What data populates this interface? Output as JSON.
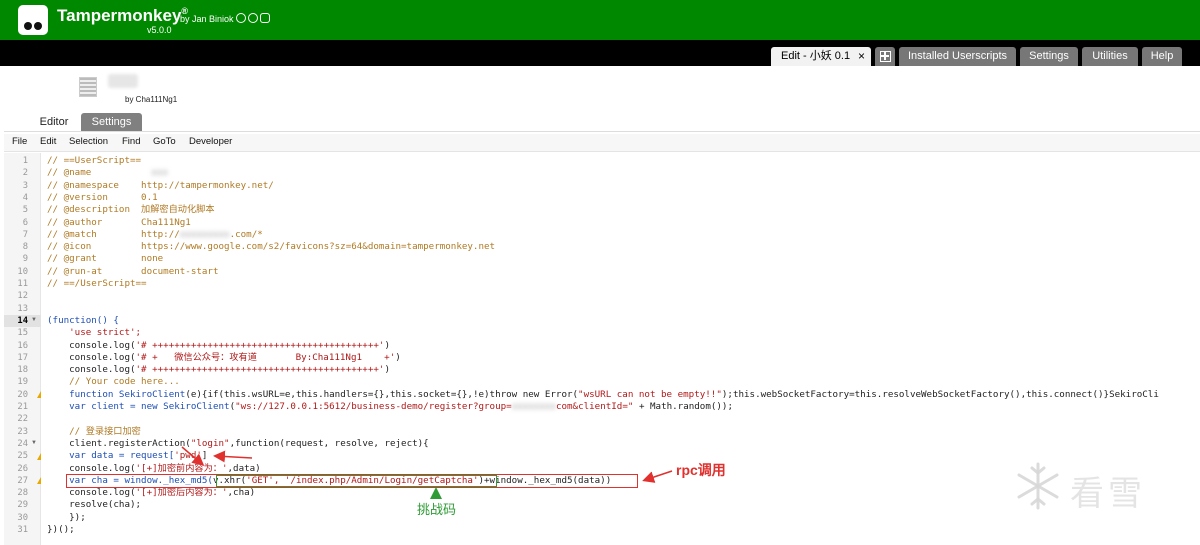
{
  "app": {
    "name": "Tampermonkey",
    "trademark": "®",
    "author": "by Jan Biniok",
    "version": "v5.0.0",
    "social_icons": [
      "github-icon",
      "facebook-icon",
      "instagram-icon"
    ]
  },
  "tabs": [
    {
      "label": "Edit - 小妖 0.1",
      "close": "×",
      "active": true
    },
    {
      "label": "",
      "icon": "plus-icon"
    },
    {
      "label": "Installed Userscripts"
    },
    {
      "label": "Settings"
    },
    {
      "label": "Utilities"
    },
    {
      "label": "Help"
    }
  ],
  "script": {
    "by": "by Cha111Ng1"
  },
  "editor_tabs": [
    "Editor",
    "Settings"
  ],
  "menu": [
    "File",
    "Edit",
    "Selection",
    "Find",
    "GoTo",
    "Developer"
  ],
  "code": {
    "l1": "// ==UserScript==",
    "l2": "// @name",
    "l3a": "// @namespace    ",
    "l3b": "http://tampermonkey.net/",
    "l4a": "// @version      ",
    "l4b": "0.1",
    "l5a": "// @description  ",
    "l5b": "加解密自动化脚本",
    "l6a": "// @author       ",
    "l6b": "Cha111Ng1",
    "l7a": "// @match        ",
    "l7b": "http://",
    "l7c": ".com/*",
    "l8a": "// @icon         ",
    "l8b": "https://www.google.com/s2/favicons?sz=64&domain=tampermonkey.net",
    "l9a": "// @grant        ",
    "l9b": "none",
    "l10a": "// @run-at       ",
    "l10b": "document-start",
    "l11": "// ==/UserScript==",
    "l14a": "(function() {",
    "l15": "    'use strict';",
    "l16a": "    console.log(",
    "l16b": "'# +++++++++++++++++++++++++++++++++++++++++'",
    "l16c": ")",
    "l17a": "    console.log(",
    "l17b": "'# +   微信公众号：攻有道       By:Cha111Ng1    +'",
    "l17c": ")",
    "l18a": "    console.log(",
    "l18b": "'# +++++++++++++++++++++++++++++++++++++++++'",
    "l18c": ")",
    "l19": "    // Your code here...",
    "l20a": "    function ",
    "l20b": "SekiroClient",
    "l20c": "(e){if(this.wsURL=e,this.handlers={},this.socket={},!e)throw new Error(",
    "l20d": "\"wsURL can not be empty!!\"",
    "l20e": ");this.webSocketFactory=this.resolveWebSocketFactory(),this.connect()}SekiroCli",
    "l21a": "    var client = new ",
    "l21b": "SekiroClient",
    "l21c": "(",
    "l21d": "\"ws://127.0.0.1:5612/business-demo/register?group=",
    "l21e": "com&clientId=\"",
    "l21f": " + Math.random());",
    "l23": "    // 登录接口加密",
    "l24a": "    client.registerAction(",
    "l24b": "\"login\"",
    "l24c": ",function(request, resolve, reject){",
    "l25a": "    var data = request[",
    "l25b": "'pwd'",
    "l25c": "]",
    "l26a": "    console.log(",
    "l26b": "'[+]加密前内容为：'",
    "l26c": ",data)",
    "l27a": "    var cha = window._hex_md5(",
    "l27b": "v.xhr(",
    "l27c": "'GET', '/index.php/Admin/Login/getCaptcha'",
    "l27d": ")+window._hex_md5(data))",
    "l28a": "    console.log(",
    "l28b": "'[+]加密后内容为：'",
    "l28c": ",cha)",
    "l29": "    resolve(cha);",
    "l30": "    });",
    "l31": "})();"
  },
  "annotations": {
    "rpc": "rpc调用",
    "challenge": "挑战码"
  },
  "watermark": {
    "text": "看雪"
  },
  "colors": {
    "header_green": "#008800",
    "annotation_red": "#e0312e",
    "annotation_green": "#2e9b34"
  }
}
